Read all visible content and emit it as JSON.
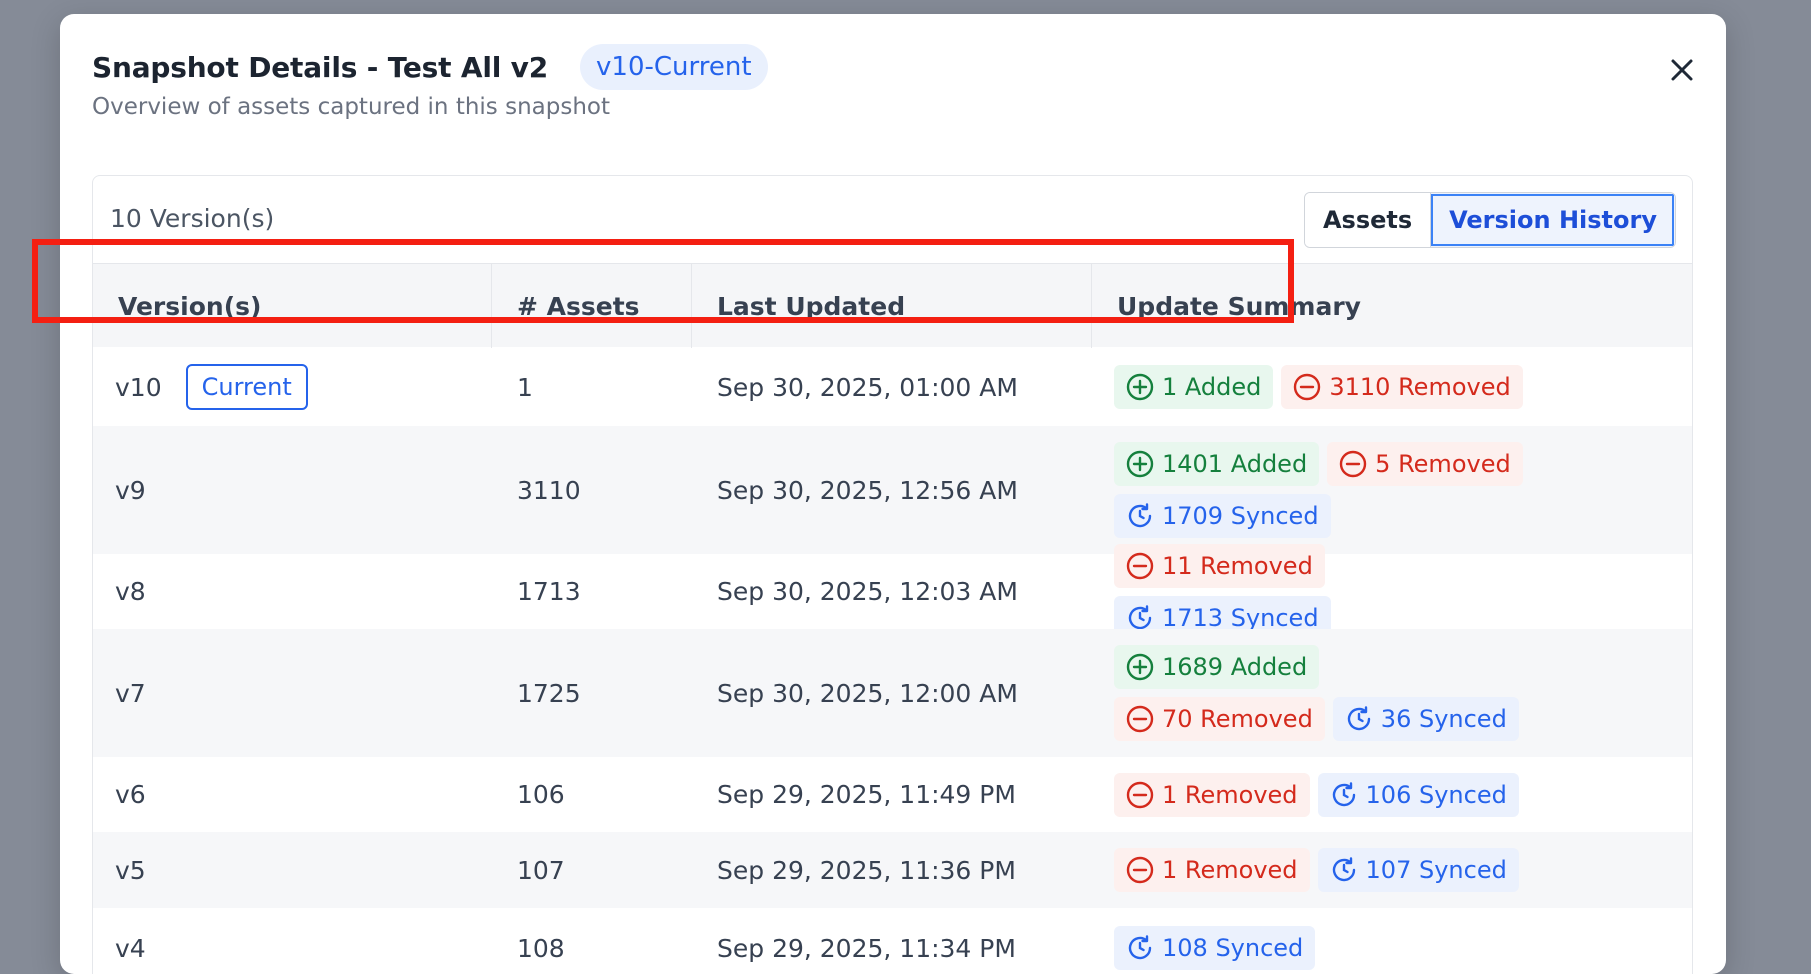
{
  "modal": {
    "title": "Snapshot Details - Test All v2",
    "version_chip": "v10-Current",
    "subtitle": "Overview of assets captured in this snapshot",
    "close_icon": "close-icon"
  },
  "panel": {
    "count_label": "10 Version(s)",
    "toggle": {
      "assets": "Assets",
      "version_history": "Version History",
      "active": "version_history"
    }
  },
  "table": {
    "columns": [
      "Version(s)",
      "# Assets",
      "Last Updated",
      "Update Summary"
    ],
    "rows": [
      {
        "version": "v10",
        "badge": "Current",
        "assets": "1",
        "updated": "Sep 30, 2025, 01:00 AM",
        "chips": [
          {
            "type": "added",
            "text": "1 Added"
          },
          {
            "type": "removed",
            "text": "3110 Removed"
          }
        ]
      },
      {
        "version": "v9",
        "assets": "3110",
        "updated": "Sep 30, 2025, 12:56 AM",
        "chips": [
          {
            "type": "added",
            "text": "1401 Added"
          },
          {
            "type": "removed",
            "text": "5 Removed"
          },
          {
            "type": "synced",
            "text": "1709 Synced"
          }
        ]
      },
      {
        "version": "v8",
        "assets": "1713",
        "updated": "Sep 30, 2025, 12:03 AM",
        "chips": [
          {
            "type": "removed",
            "text": "11 Removed"
          },
          {
            "type": "synced",
            "text": "1713 Synced"
          }
        ]
      },
      {
        "version": "v7",
        "assets": "1725",
        "updated": "Sep 30, 2025, 12:00 AM",
        "chips": [
          {
            "type": "added",
            "text": "1689 Added"
          },
          {
            "type": "removed",
            "text": "70 Removed"
          },
          {
            "type": "synced",
            "text": "36 Synced"
          }
        ]
      },
      {
        "version": "v6",
        "assets": "106",
        "updated": "Sep 29, 2025, 11:49 PM",
        "chips": [
          {
            "type": "removed",
            "text": "1 Removed"
          },
          {
            "type": "synced",
            "text": "106 Synced"
          }
        ]
      },
      {
        "version": "v5",
        "assets": "107",
        "updated": "Sep 29, 2025, 11:36 PM",
        "chips": [
          {
            "type": "removed",
            "text": "1 Removed"
          },
          {
            "type": "synced",
            "text": "107 Synced"
          }
        ]
      },
      {
        "version": "v4",
        "assets": "108",
        "updated": "Sep 29, 2025, 11:34 PM",
        "chips": [
          {
            "type": "synced",
            "text": "108 Synced"
          }
        ]
      }
    ]
  },
  "colors": {
    "accent": "#2563eb",
    "added": "#15803d",
    "removed": "#d42a1c",
    "highlight": "#f41f12"
  }
}
